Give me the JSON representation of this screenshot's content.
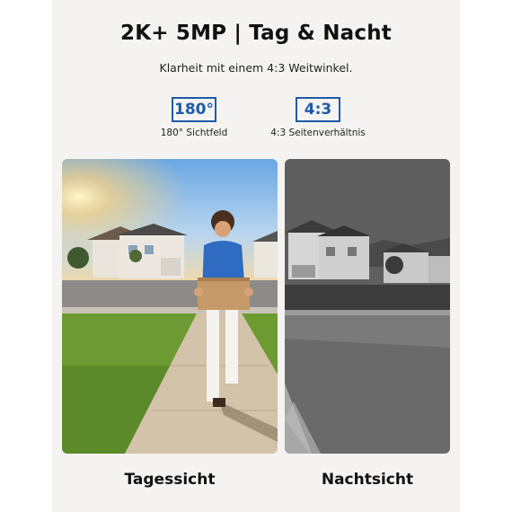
{
  "header": {
    "title": "2K+ 5MP | Tag & Nacht",
    "subtitle": "Klarheit mit einem 4:3 Weitwinkel."
  },
  "features": [
    {
      "badge": "180°",
      "label": "180° Sichtfeld"
    },
    {
      "badge": "4:3",
      "label": "4:3 Seitenverhältnis"
    }
  ],
  "photos": {
    "day_caption": "Tagessicht",
    "night_caption": "Nachtsicht"
  },
  "colors": {
    "accent": "#1f5aa6",
    "background": "#f4f3f1"
  }
}
